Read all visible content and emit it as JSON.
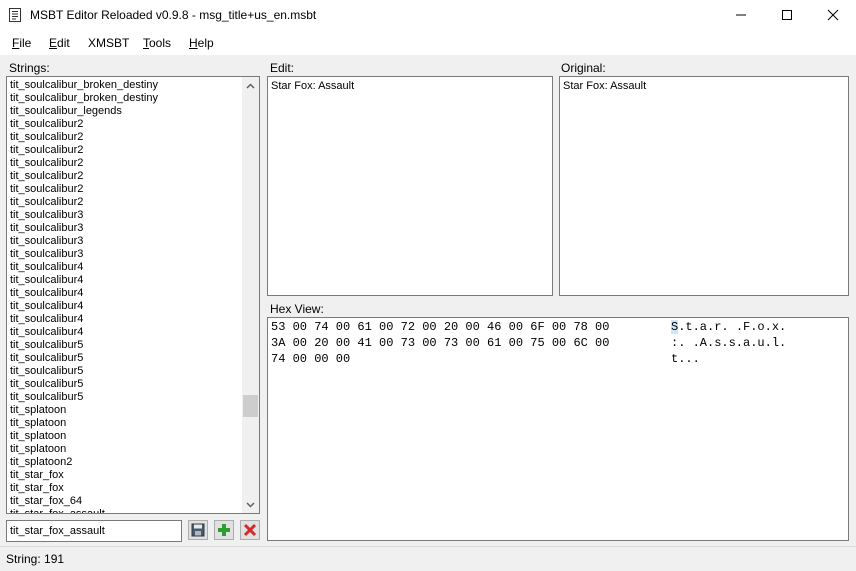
{
  "window": {
    "title": "MSBT Editor Reloaded v0.9.8 - msg_title+us_en.msbt",
    "icons": [
      "app-icon",
      "minimize-icon",
      "maximize-icon",
      "close-icon"
    ]
  },
  "menu": {
    "items": [
      {
        "label": "File",
        "key": "F",
        "rest": "ile"
      },
      {
        "label": "Edit",
        "key": "E",
        "rest": "dit"
      },
      {
        "label": "XMSBT",
        "key": "",
        "rest": "XMSBT"
      },
      {
        "label": "Tools",
        "key": "T",
        "rest": "ools"
      },
      {
        "label": "Help",
        "key": "H",
        "rest": "elp"
      }
    ]
  },
  "strings": {
    "label": "Strings:",
    "items": [
      "tit_soulcalibur_broken_destiny",
      "tit_soulcalibur_broken_destiny",
      "tit_soulcalibur_legends",
      "tit_soulcalibur2",
      "tit_soulcalibur2",
      "tit_soulcalibur2",
      "tit_soulcalibur2",
      "tit_soulcalibur2",
      "tit_soulcalibur2",
      "tit_soulcalibur2",
      "tit_soulcalibur3",
      "tit_soulcalibur3",
      "tit_soulcalibur3",
      "tit_soulcalibur3",
      "tit_soulcalibur4",
      "tit_soulcalibur4",
      "tit_soulcalibur4",
      "tit_soulcalibur4",
      "tit_soulcalibur4",
      "tit_soulcalibur4",
      "tit_soulcalibur5",
      "tit_soulcalibur5",
      "tit_soulcalibur5",
      "tit_soulcalibur5",
      "tit_soulcalibur5",
      "tit_splatoon",
      "tit_splatoon",
      "tit_splatoon",
      "tit_splatoon",
      "tit_splatoon2",
      "tit_star_fox",
      "tit_star_fox",
      "tit_star_fox_64",
      "tit_star_fox_assault"
    ],
    "scroll_position": 0.72,
    "search_value": "tit_star_fox_assault"
  },
  "toolbar": {
    "icons": [
      "save-icon",
      "add-icon",
      "delete-icon"
    ]
  },
  "edit": {
    "label": "Edit:",
    "value": "Star Fox: Assault"
  },
  "original": {
    "label": "Original:",
    "value": "Star Fox: Assault"
  },
  "hex": {
    "label": "Hex View:",
    "hex_lines": [
      "53 00 74 00 61 00 72 00 20 00 46 00 6F 00 78 00",
      "3A 00 20 00 41 00 73 00 73 00 61 00 75 00 6C 00",
      "74 00 00 00"
    ],
    "ascii_first_char": "S",
    "ascii_lines": [
      ".t.a.r. .F.o.x.",
      ":. .A.s.s.a.u.l.",
      "t..."
    ]
  },
  "status": {
    "text": "String: 191"
  },
  "colors": {
    "selection": "#cce8ff",
    "add_green": "#2e9e2e",
    "delete_red": "#d42a2a"
  }
}
